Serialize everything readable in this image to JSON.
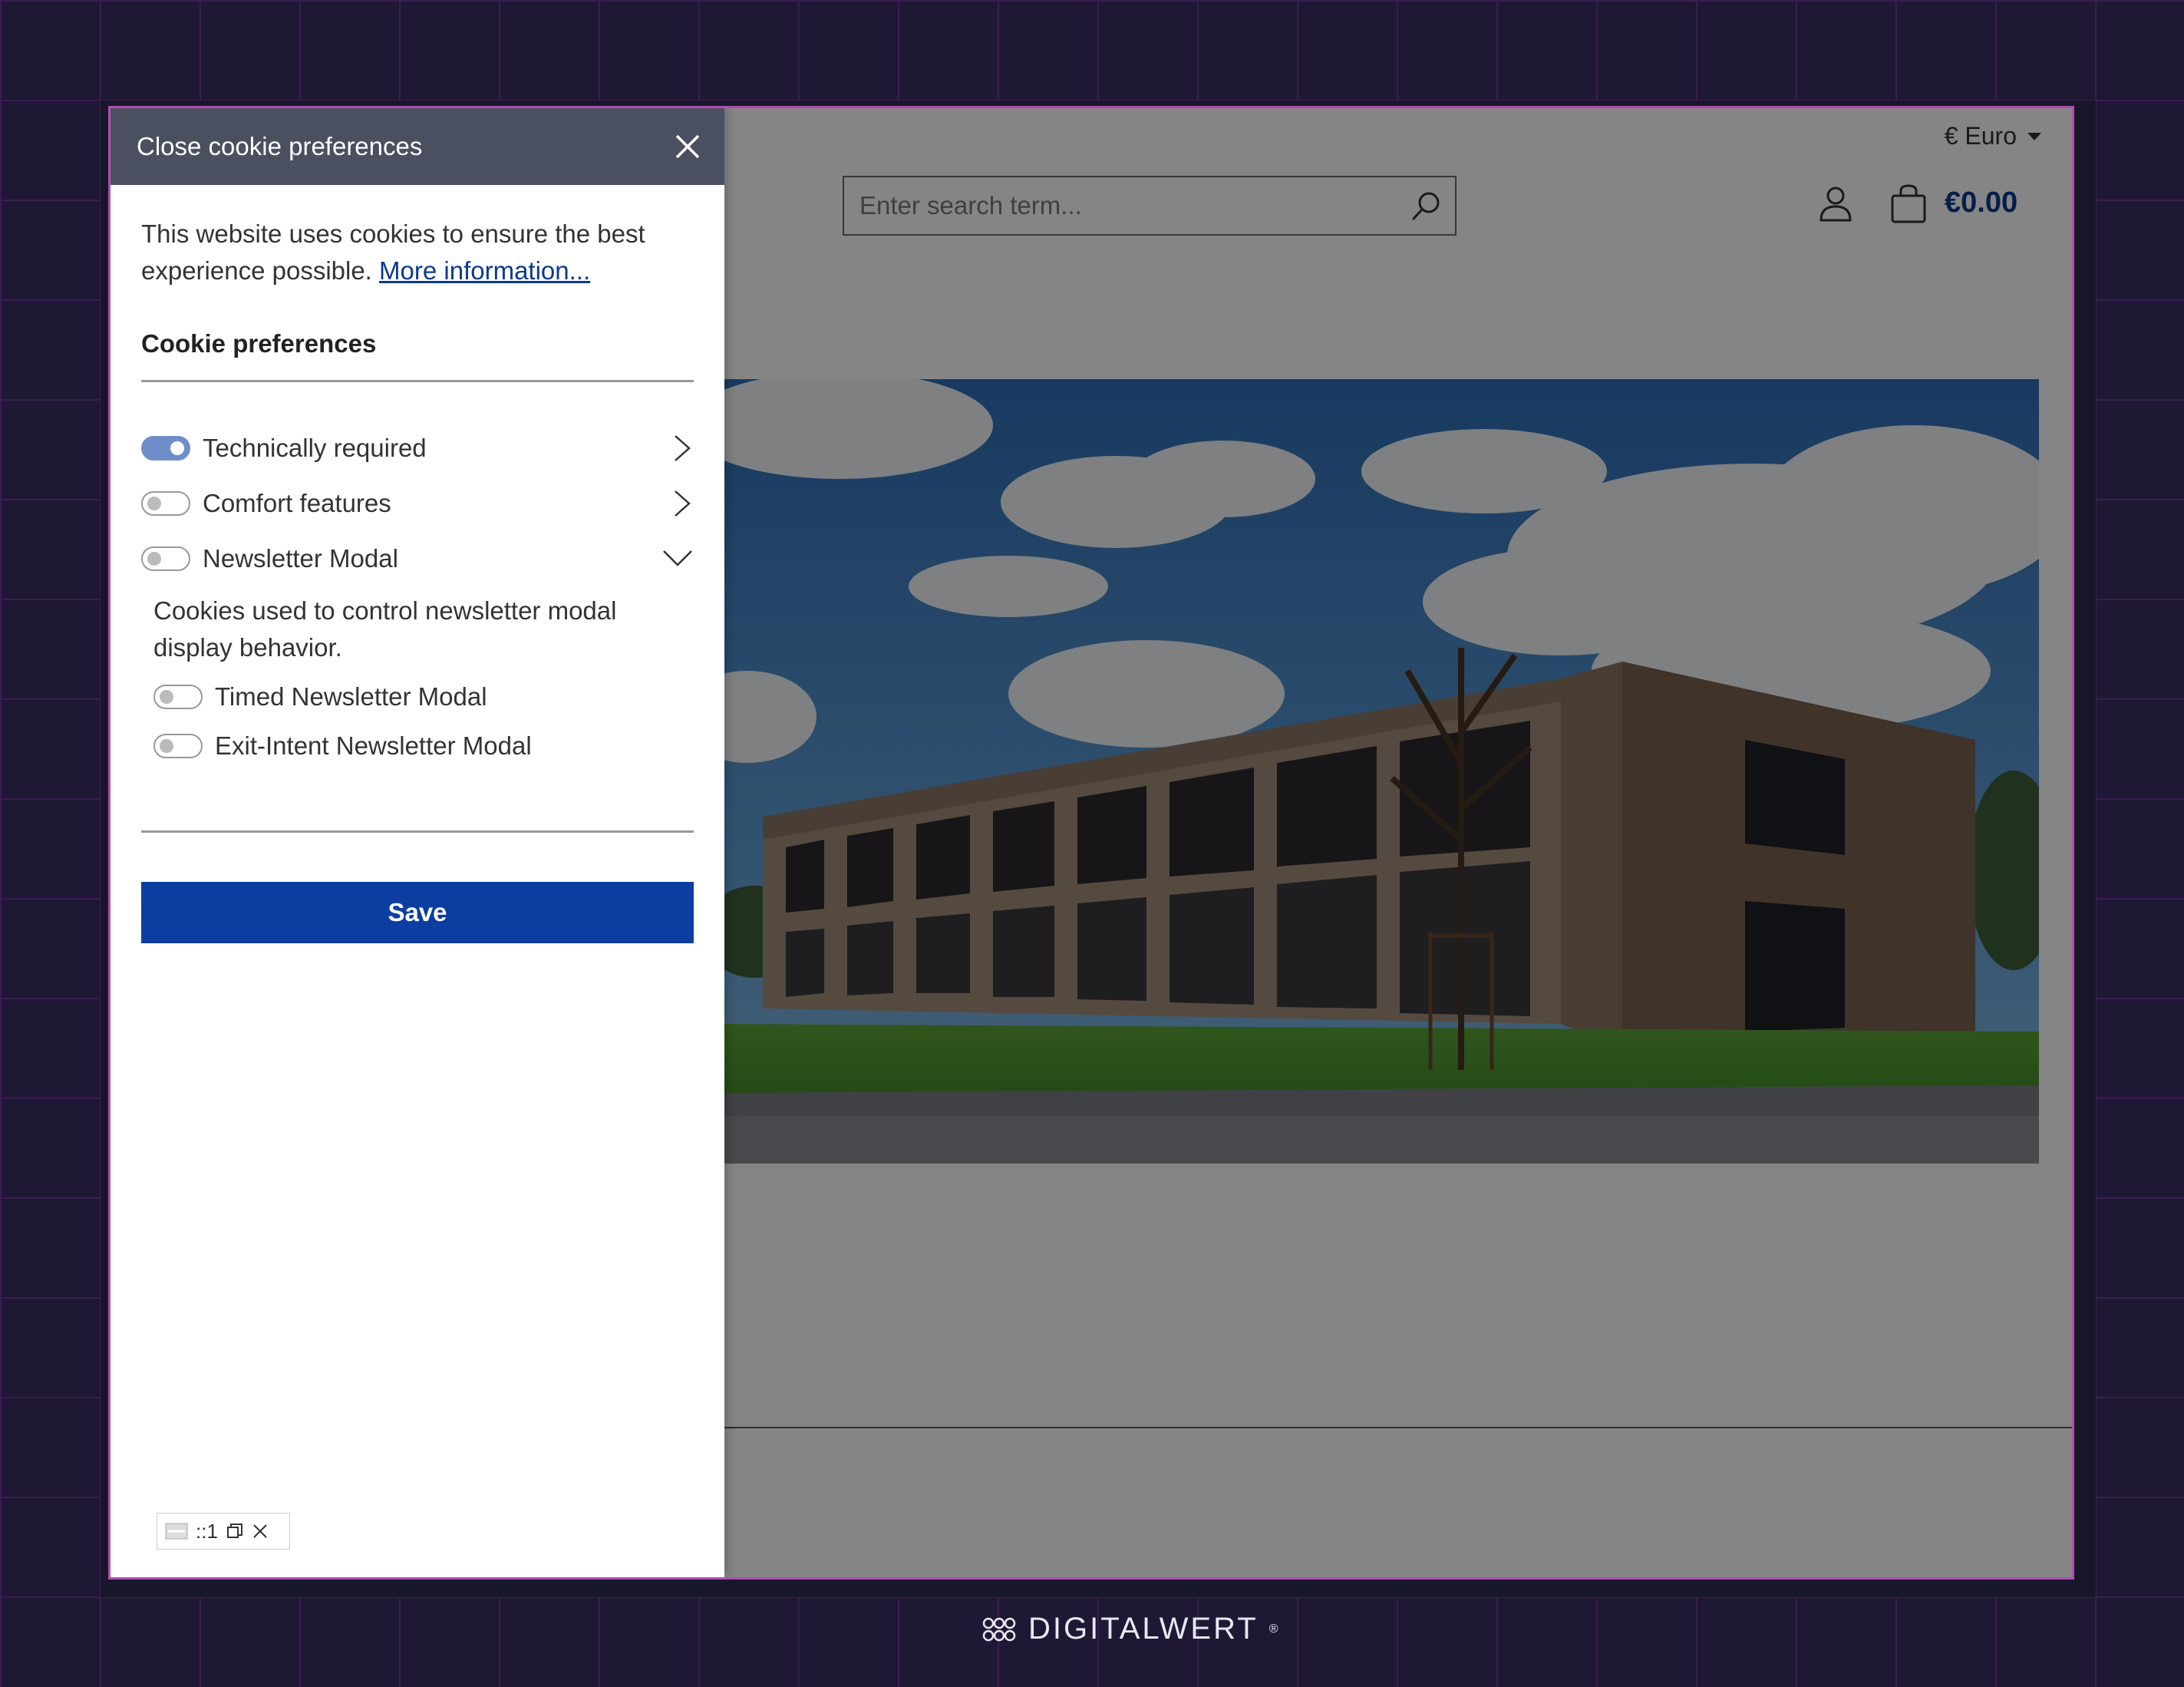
{
  "header": {
    "currency": "€ Euro",
    "search_placeholder": "Enter search term...",
    "cart_total": "€0.00"
  },
  "cookie_panel": {
    "title": "Close cookie preferences",
    "intro": "This website uses cookies to ensure the best experience possible.",
    "more_info": "More information...",
    "prefs_title": "Cookie preferences",
    "groups": [
      {
        "label": "Technically required",
        "enabled": true,
        "expanded": false
      },
      {
        "label": "Comfort features",
        "enabled": false,
        "expanded": false
      },
      {
        "label": "Newsletter Modal",
        "enabled": false,
        "expanded": true
      }
    ],
    "newsletter_desc": "Cookies used to control newsletter modal display behavior.",
    "sub_items": [
      {
        "label": "Timed Newsletter Modal",
        "enabled": false
      },
      {
        "label": "Exit-Intent Newsletter Modal",
        "enabled": false
      }
    ],
    "save_label": "Save"
  },
  "mini_toolbar": {
    "text": "::1"
  },
  "brand": {
    "name": "DIGITALWERT",
    "mark": "®"
  },
  "colors": {
    "primary": "#0b3ea0",
    "header_bg": "#4a5060",
    "price": "#0b3a8e",
    "frame": "#b04db0"
  }
}
